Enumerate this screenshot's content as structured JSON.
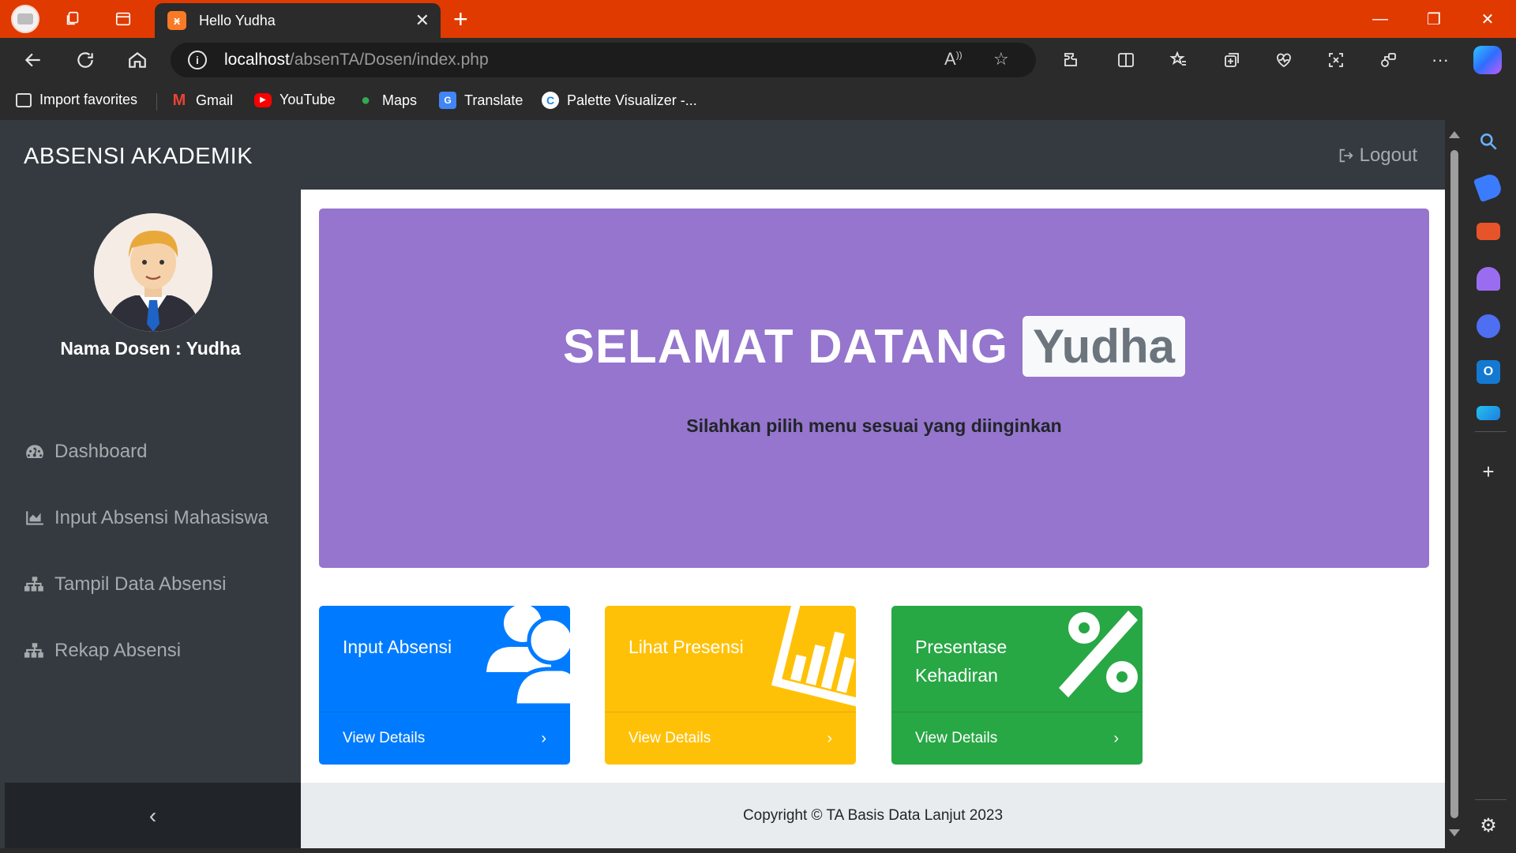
{
  "browser": {
    "tab_title": "Hello Yudha",
    "tab_favicon": "xampp-icon",
    "url_host": "localhost",
    "url_path": "/absenTA/Dosen/index.php",
    "accent_color": "#e03a00",
    "bookmarks": [
      {
        "label": "Import favorites",
        "icon": "import-icon"
      },
      {
        "label": "Gmail",
        "icon": "gmail-icon"
      },
      {
        "label": "YouTube",
        "icon": "youtube-icon"
      },
      {
        "label": "Maps",
        "icon": "maps-icon"
      },
      {
        "label": "Translate",
        "icon": "translate-icon"
      },
      {
        "label": "Palette Visualizer -...",
        "icon": "palette-icon"
      }
    ]
  },
  "app": {
    "brand": "ABSENSI AKADEMIK",
    "logout_label": "Logout",
    "dosen_label": "Nama Dosen : Yudha",
    "menu": [
      {
        "label": "Dashboard",
        "icon": "dashboard-icon"
      },
      {
        "label": "Input Absensi Mahasiswa",
        "icon": "area-chart-icon"
      },
      {
        "label": "Tampil Data Absensi",
        "icon": "sitemap-icon"
      },
      {
        "label": "Rekap Absensi",
        "icon": "sitemap-icon"
      }
    ],
    "sidebar_toggle": "‹"
  },
  "hero": {
    "title": "SELAMAT DATANG",
    "name": "Yudha",
    "subtitle": "Silahkan pilih menu sesuai yang diinginkan",
    "bg_color": "#9575cd"
  },
  "cards": [
    {
      "title": "Input Absensi",
      "link": "View Details",
      "color": "#007bff",
      "icon": "users-icon"
    },
    {
      "title": "Lihat Presensi",
      "link": "View Details",
      "color": "#ffc107",
      "icon": "bar-chart-icon"
    },
    {
      "title": "Presentase Kehadiran",
      "link": "View Details",
      "color": "#28a745",
      "icon": "percent-icon"
    }
  ],
  "footer": {
    "text": "Copyright © TA Basis Data Lanjut 2023"
  }
}
